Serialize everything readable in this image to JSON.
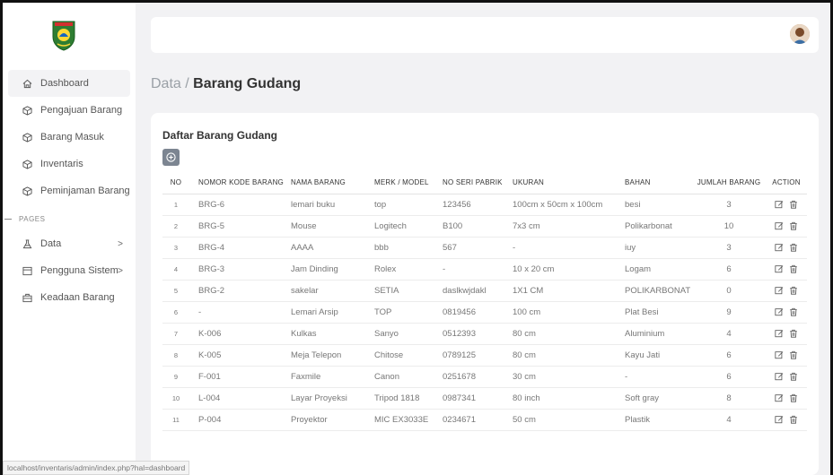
{
  "sidebar": {
    "items": [
      {
        "label": "Dashboard",
        "icon": "home-icon"
      },
      {
        "label": "Pengajuan Barang",
        "icon": "box-icon"
      },
      {
        "label": "Barang Masuk",
        "icon": "box-icon"
      },
      {
        "label": "Inventaris",
        "icon": "box-icon"
      },
      {
        "label": "Peminjaman Barang",
        "icon": "box-icon"
      }
    ],
    "section_label": "PAGES",
    "pages": [
      {
        "label": "Data",
        "icon": "flask-icon",
        "chevron": ">"
      },
      {
        "label": "Pengguna Sistem",
        "icon": "list-icon",
        "chevron": ">"
      },
      {
        "label": "Keadaan Barang",
        "icon": "briefcase-icon"
      }
    ]
  },
  "breadcrumb": {
    "parent": "Data",
    "sep": " / ",
    "current": "Barang Gudang"
  },
  "card": {
    "title": "Daftar Barang Gudang",
    "add_icon": "plus-circle-icon",
    "headers": [
      "NO",
      "NOMOR KODE BARANG",
      "NAMA BARANG",
      "MERK / MODEL",
      "NO SERI PABRIK",
      "UKURAN",
      "BAHAN",
      "JUMLAH BARANG",
      "ACTION"
    ],
    "rows": [
      [
        "1",
        "BRG-6",
        "lemari buku",
        "top",
        "123456",
        "100cm x 50cm x 100cm",
        "besi",
        "3"
      ],
      [
        "2",
        "BRG-5",
        "Mouse",
        "Logitech",
        "B100",
        "7x3 cm",
        "Polikarbonat",
        "10"
      ],
      [
        "3",
        "BRG-4",
        "AAAA",
        "bbb",
        "567",
        "-",
        "iuy",
        "3"
      ],
      [
        "4",
        "BRG-3",
        "Jam Dinding",
        "Rolex",
        "-",
        "10 x 20 cm",
        "Logam",
        "6"
      ],
      [
        "5",
        "BRG-2",
        "sakelar",
        "SETIA",
        "daslkwjdakl",
        "1X1 CM",
        "POLIKARBONAT",
        "0"
      ],
      [
        "6",
        "-",
        "Lemari Arsip",
        "TOP",
        "0819456",
        "100 cm",
        "Plat Besi",
        "9"
      ],
      [
        "7",
        "K-006",
        "Kulkas",
        "Sanyo",
        "0512393",
        "80 cm",
        "Aluminium",
        "4"
      ],
      [
        "8",
        "K-005",
        "Meja Telepon",
        "Chitose",
        "0789125",
        "80 cm",
        "Kayu Jati",
        "6"
      ],
      [
        "9",
        "F-001",
        "Faxmile",
        "Canon",
        "0251678",
        "30 cm",
        "-",
        "6"
      ],
      [
        "10",
        "L-004",
        "Layar Proyeksi",
        "Tripod 1818",
        "0987341",
        "80 inch",
        "Soft gray",
        "8"
      ],
      [
        "11",
        "P-004",
        "Proyektor",
        "MIC EX3033E",
        "0234671",
        "50 cm",
        "Plastik",
        "4"
      ]
    ],
    "actions": [
      "edit-icon",
      "trash-icon"
    ]
  },
  "statusbar": {
    "url": "localhost/inventaris/admin/index.php?hal=dashboard"
  },
  "colors": {
    "accent_button": "#7c8591",
    "text_dark": "#333333",
    "text_muted": "#777777"
  }
}
